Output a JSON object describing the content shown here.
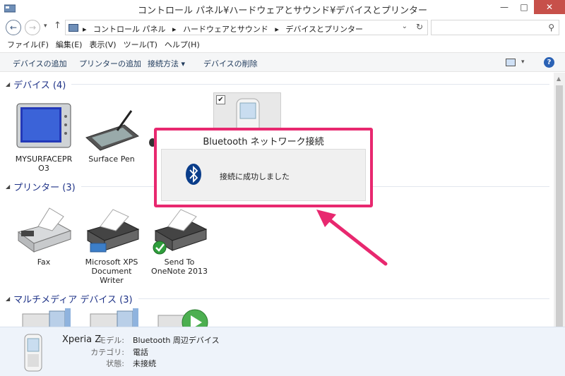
{
  "window": {
    "title": "コントロール パネル¥ハードウェアとサウンド¥デバイスとプリンター",
    "minimize": "—",
    "maximize": "□",
    "close": "✕"
  },
  "nav": {
    "back": "←",
    "forward": "→",
    "recent": "▾",
    "up": "↑",
    "breadcrumbs": [
      "コントロール パネル",
      "ハードウェアとサウンド",
      "デバイスとプリンター"
    ],
    "separator": "▸",
    "dropdown": "⌄",
    "refresh": "↻",
    "search_placeholder": "",
    "search_icon": "⚲"
  },
  "menu": [
    "ファイル(F)",
    "編集(E)",
    "表示(V)",
    "ツール(T)",
    "ヘルプ(H)"
  ],
  "commands": {
    "add_device": "デバイスの追加",
    "add_printer": "プリンターの追加",
    "connect_via": "接続方法 ▾",
    "remove_device": "デバイスの削除",
    "view_dd": "▾",
    "help": "?"
  },
  "groups": {
    "devices": {
      "title": "デバイス (4)",
      "items": [
        "MYSURFACEPRO3",
        "Surface Pen"
      ]
    },
    "printers": {
      "title": "プリンター (3)",
      "items": [
        "Fax",
        "Microsoft XPS Document Writer",
        "Send To OneNote 2013"
      ]
    },
    "multimedia": {
      "title": "マルチメディア デバイス (3)"
    }
  },
  "device_label_lines": {
    "d1": [
      "MYSURFACEPR",
      "O3"
    ],
    "p2": [
      "Microsoft XPS",
      "Document",
      "Writer"
    ],
    "p3": [
      "Send To",
      "OneNote 2013"
    ]
  },
  "checkbox_mark": "✔",
  "popup": {
    "title": "Bluetooth ネットワーク接続",
    "message": "接続に成功しました"
  },
  "details": {
    "name": "Xperia Z",
    "model_label": "モデル:",
    "model_value": "Bluetooth 周辺デバイス",
    "category_label": "カテゴリ:",
    "category_value": "電話",
    "status_label": "状態:",
    "status_value": "未接続"
  },
  "colors": {
    "annotation": "#e8286f",
    "group_title": "#1e3287",
    "close_button": "#c7504a"
  }
}
